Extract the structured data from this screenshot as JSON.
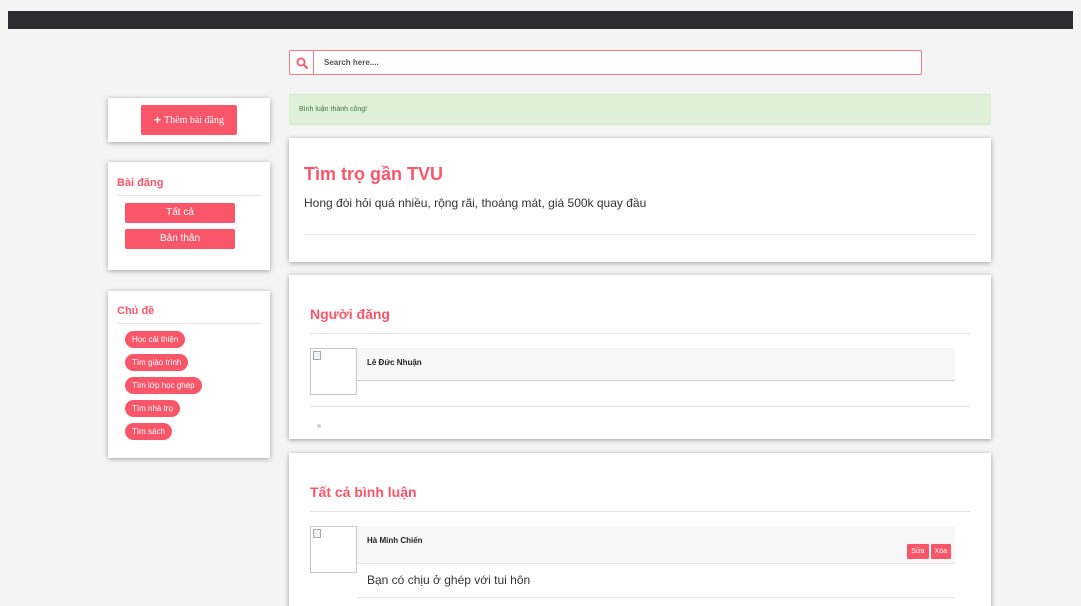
{
  "search": {
    "placeholder": "Search here...."
  },
  "sidebar": {
    "add_post_label": "Thêm bài đăng",
    "posts_section": {
      "title": "Bài đăng",
      "buttons": [
        {
          "label": "Tất cả"
        },
        {
          "label": "Bản thân"
        }
      ]
    },
    "topics_section": {
      "title": "Chủ đề",
      "tags": [
        {
          "label": "Học cải thiện"
        },
        {
          "label": "Tìm giáo trình"
        },
        {
          "label": "Tìm lớp học ghép"
        },
        {
          "label": "Tìm nhà trọ"
        },
        {
          "label": "Tìm sách"
        }
      ]
    }
  },
  "alert": {
    "message": "Bình luận thành công!"
  },
  "post": {
    "title": "Tìm trọ gần TVU",
    "body": "Hong đòi hỏi quá nhiều, rộng rãi, thoáng mát, giá 500k quay đầu"
  },
  "author_section": {
    "title": "Người đăng",
    "name": "Lê Đức Nhuận"
  },
  "comments_section": {
    "title": "Tất cả bình luận",
    "comments": [
      {
        "author": "Hà Minh Chiến",
        "text": "Bạn có chịu ở ghép với tui hôn",
        "edit_label": "Sửa",
        "delete_label": "Xóa"
      }
    ]
  },
  "colors": {
    "accent": "#f9566a",
    "topbar": "#2b2d33",
    "success_bg": "#dff0d8",
    "success_text": "#3c763d"
  }
}
